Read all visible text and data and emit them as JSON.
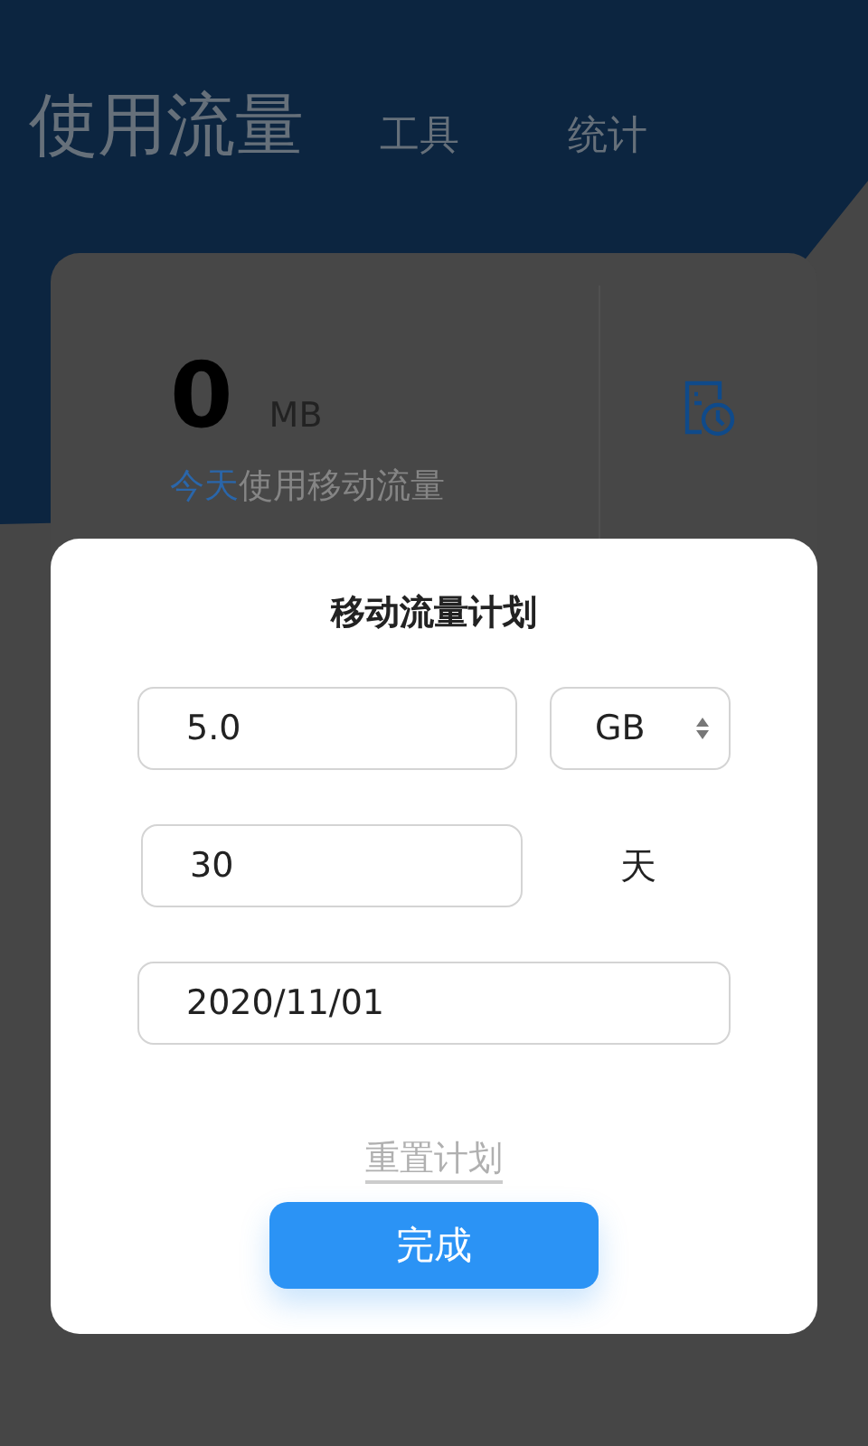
{
  "tabs": [
    {
      "label": "使用流量",
      "selected": true
    },
    {
      "label": "工具",
      "selected": false
    },
    {
      "label": "统计",
      "selected": false
    }
  ],
  "usage": {
    "value": "0",
    "unit": "MB",
    "label_highlight": "今天",
    "label_rest": "使用移动流量"
  },
  "dialog": {
    "title": "移动流量计划",
    "amount": "5.0",
    "unit": "GB",
    "days": "30",
    "days_unit": "天",
    "start_date": "2020/11/01",
    "reset_link": "重置计划",
    "done_button": "完成"
  }
}
